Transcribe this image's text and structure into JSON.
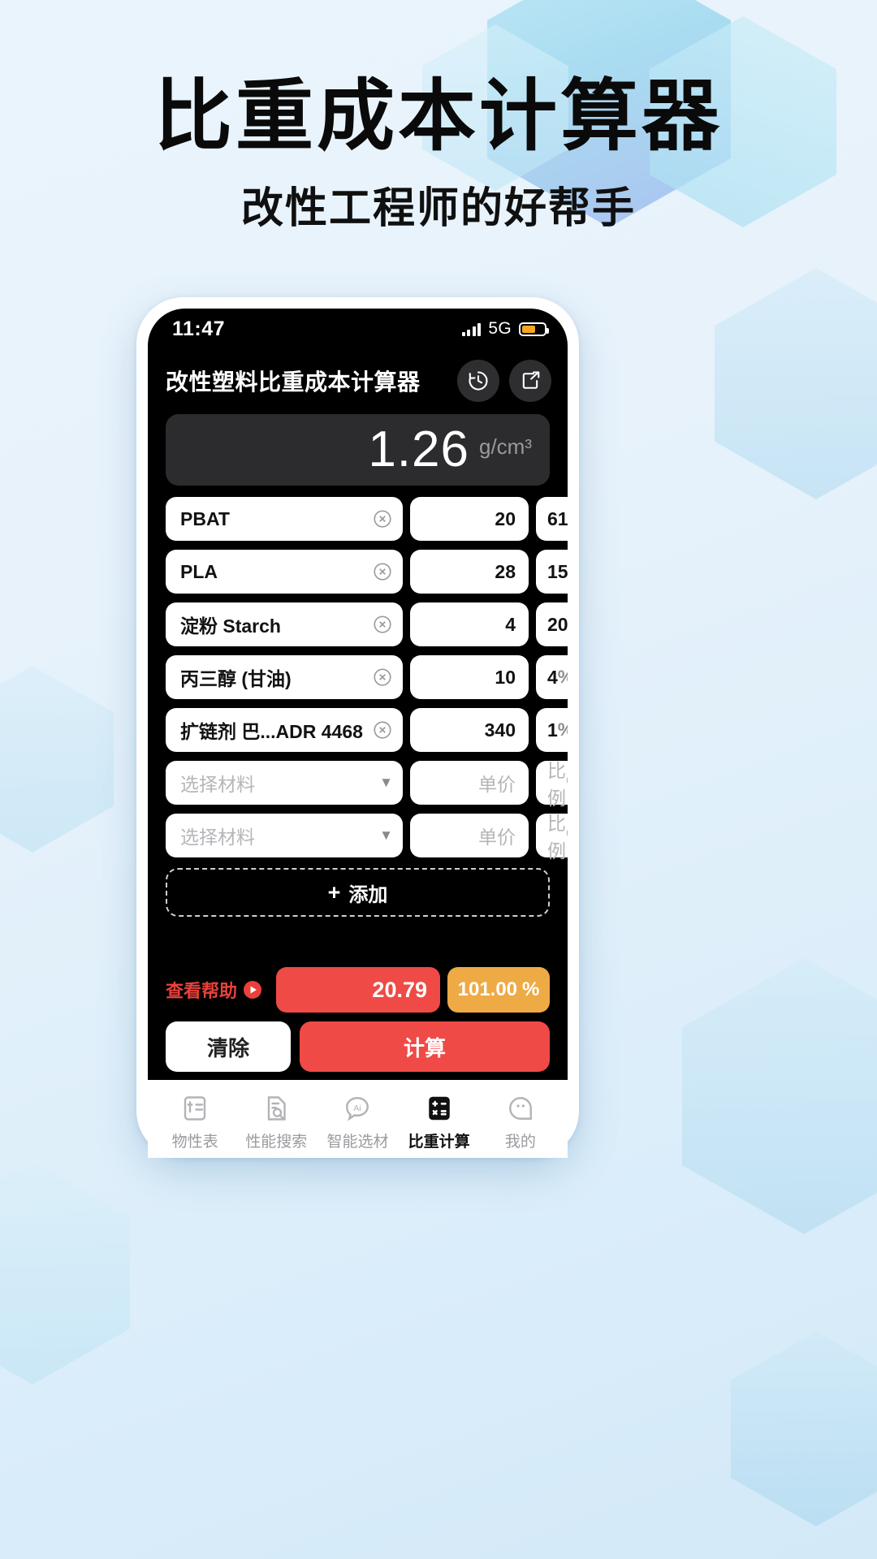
{
  "poster": {
    "title": "比重成本计算器",
    "subtitle": "改性工程师的好帮手"
  },
  "status_bar": {
    "time": "11:47",
    "network": "5G",
    "signal_icon": "signal-bars-icon",
    "battery_icon": "battery-icon",
    "battery_color": "#f5a623"
  },
  "app_header": {
    "title": "改性塑料比重成本计算器",
    "history_icon": "history-clock-icon",
    "share_icon": "share-export-icon"
  },
  "display": {
    "value": "1.26",
    "unit": "g/cm³"
  },
  "placeholders": {
    "material": "选择材料",
    "price": "单价",
    "percent": "比例",
    "percent_symbol": "%"
  },
  "rows": [
    {
      "name": "PBAT",
      "price": "20",
      "percent": "61",
      "symbol": "%",
      "filled": true
    },
    {
      "name": "PLA",
      "price": "28",
      "percent": "15",
      "symbol": "%",
      "filled": true
    },
    {
      "name": "淀粉 Starch",
      "price": "4",
      "percent": "20",
      "symbol": "%",
      "filled": true
    },
    {
      "name": "丙三醇 (甘油)",
      "price": "10",
      "percent": "4",
      "symbol": "%",
      "filled": true
    },
    {
      "name": "扩链剂 巴...ADR 4468",
      "price": "340",
      "percent": "1",
      "symbol": "%",
      "filled": true
    },
    {
      "name": "选择材料",
      "price": "单价",
      "percent": "比例",
      "symbol": "%",
      "filled": false
    },
    {
      "name": "选择材料",
      "price": "单价",
      "percent": "比例",
      "symbol": "%",
      "filled": false
    }
  ],
  "add_button": {
    "plus": "+",
    "label": "添加"
  },
  "summary": {
    "help_label": "查看帮助",
    "help_icon": "play-circle-icon",
    "total_cost": "20.79",
    "total_percent": "101.00",
    "percent_symbol": "%",
    "total_color": "#ef4a46",
    "percent_color": "#eeaa45"
  },
  "actions": {
    "clear_label": "清除",
    "calculate_label": "计算"
  },
  "tabbar": {
    "items": [
      {
        "label": "物性表",
        "icon": "properties-table-icon",
        "active": false
      },
      {
        "label": "性能搜索",
        "icon": "document-search-icon",
        "active": false
      },
      {
        "label": "智能选材",
        "icon": "ai-chat-icon",
        "active": false
      },
      {
        "label": "比重计算",
        "icon": "calculator-icon",
        "active": true
      },
      {
        "label": "我的",
        "icon": "profile-face-icon",
        "active": false
      }
    ]
  }
}
